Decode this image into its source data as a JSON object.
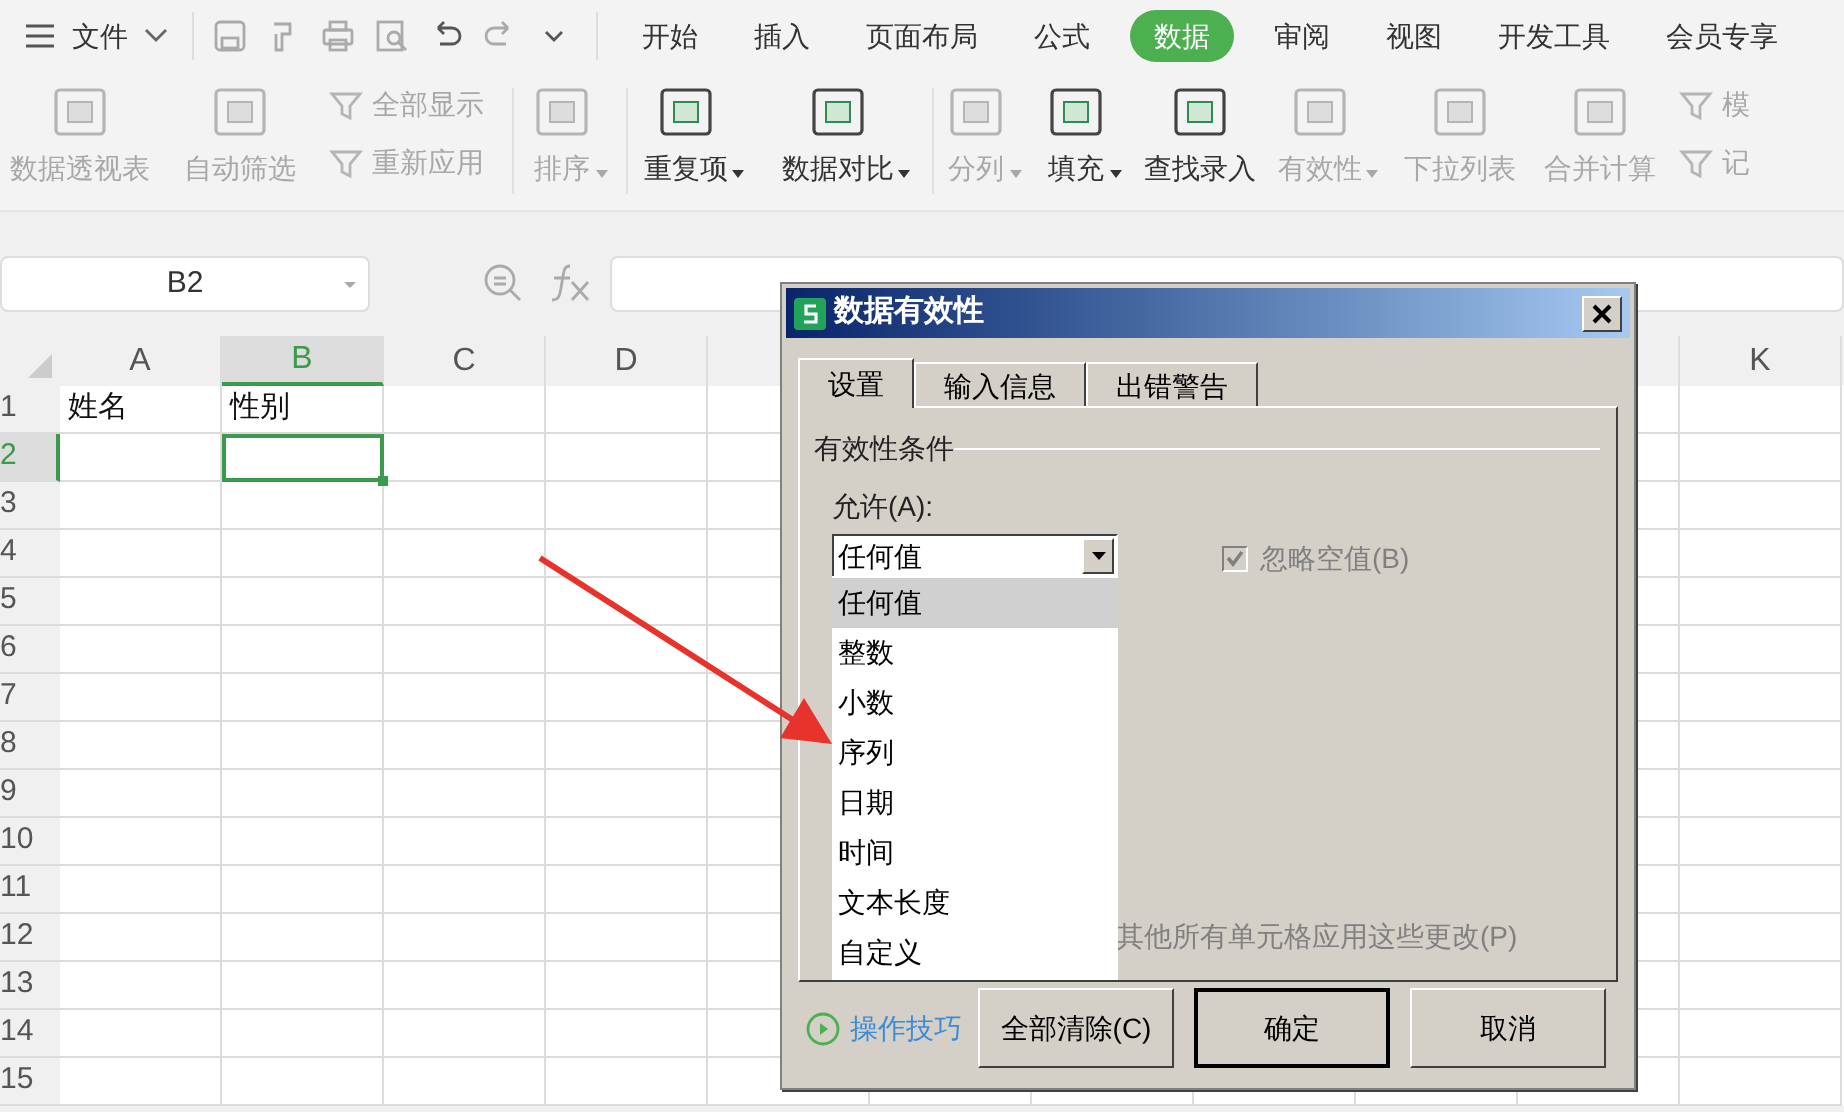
{
  "menu": {
    "file_label": "文件"
  },
  "tabs": [
    {
      "label": "开始",
      "selected": false
    },
    {
      "label": "插入",
      "selected": false
    },
    {
      "label": "页面布局",
      "selected": false
    },
    {
      "label": "公式",
      "selected": false
    },
    {
      "label": "数据",
      "selected": true
    },
    {
      "label": "审阅",
      "selected": false
    },
    {
      "label": "视图",
      "selected": false
    },
    {
      "label": "开发工具",
      "selected": false
    },
    {
      "label": "会员专享",
      "selected": false
    }
  ],
  "ribbon": [
    {
      "kind": "big",
      "label": "数据透视表",
      "disabled": true,
      "dropdown": false
    },
    {
      "kind": "big",
      "label": "自动筛选",
      "disabled": true,
      "dropdown": false
    },
    {
      "kind": "pair",
      "labels": [
        "全部显示",
        "重新应用"
      ],
      "disabled": true
    },
    {
      "kind": "big",
      "label": "排序",
      "disabled": true,
      "dropdown": true
    },
    {
      "kind": "big",
      "label": "重复项",
      "disabled": false,
      "dropdown": true
    },
    {
      "kind": "big",
      "label": "数据对比",
      "disabled": false,
      "dropdown": true
    },
    {
      "kind": "big",
      "label": "分列",
      "disabled": true,
      "dropdown": true
    },
    {
      "kind": "big",
      "label": "填充",
      "disabled": false,
      "dropdown": true
    },
    {
      "kind": "big",
      "label": "查找录入",
      "disabled": false,
      "dropdown": false
    },
    {
      "kind": "big",
      "label": "有效性",
      "disabled": true,
      "dropdown": true
    },
    {
      "kind": "big",
      "label": "下拉列表",
      "disabled": true,
      "dropdown": false
    },
    {
      "kind": "big",
      "label": "合并计算",
      "disabled": true,
      "dropdown": false
    },
    {
      "kind": "pair",
      "labels": [
        "模",
        "记"
      ],
      "disabled": true
    }
  ],
  "name_box": {
    "value": "B2"
  },
  "sheet": {
    "columns": [
      {
        "label": "A",
        "selected": false
      },
      {
        "label": "B",
        "selected": true
      },
      {
        "label": "C",
        "selected": false
      },
      {
        "label": "D",
        "selected": false
      },
      {
        "label": "K",
        "selected": false
      }
    ],
    "rows": [
      {
        "label": "1",
        "selected": false,
        "cells": [
          "姓名",
          "性别"
        ]
      },
      {
        "label": "2",
        "selected": true,
        "cells": []
      },
      {
        "label": "3",
        "selected": false,
        "cells": []
      },
      {
        "label": "4",
        "selected": false,
        "cells": []
      },
      {
        "label": "5",
        "selected": false,
        "cells": []
      },
      {
        "label": "6",
        "selected": false,
        "cells": []
      },
      {
        "label": "7",
        "selected": false,
        "cells": []
      },
      {
        "label": "8",
        "selected": false,
        "cells": []
      },
      {
        "label": "9",
        "selected": false,
        "cells": []
      },
      {
        "label": "10",
        "selected": false,
        "cells": []
      },
      {
        "label": "11",
        "selected": false,
        "cells": []
      },
      {
        "label": "12",
        "selected": false,
        "cells": []
      },
      {
        "label": "13",
        "selected": false,
        "cells": []
      },
      {
        "label": "14",
        "selected": false,
        "cells": []
      },
      {
        "label": "15",
        "selected": false,
        "cells": []
      }
    ]
  },
  "dialog": {
    "title": "数据有效性",
    "tabs": [
      {
        "label": "设置",
        "selected": true
      },
      {
        "label": "输入信息",
        "selected": false
      },
      {
        "label": "出错警告",
        "selected": false
      }
    ],
    "group_title": "有效性条件",
    "allow_label": "允许(A):",
    "allow_value": "任何值",
    "options": [
      {
        "label": "任何值",
        "selected": true
      },
      {
        "label": "整数",
        "selected": false
      },
      {
        "label": "小数",
        "selected": false
      },
      {
        "label": "序列",
        "selected": false
      },
      {
        "label": "日期",
        "selected": false
      },
      {
        "label": "时间",
        "selected": false
      },
      {
        "label": "文本长度",
        "selected": false
      },
      {
        "label": "自定义",
        "selected": false
      }
    ],
    "ignore_blank": {
      "label": "忽略空值(B)",
      "checked": true,
      "disabled": true
    },
    "apply_all_label": "其他所有单元格应用这些更改(P)",
    "tips_link": "操作技巧",
    "buttons": [
      {
        "label": "全部清除(C)",
        "default": false
      },
      {
        "label": "确定",
        "default": true
      },
      {
        "label": "取消",
        "default": false
      }
    ]
  }
}
